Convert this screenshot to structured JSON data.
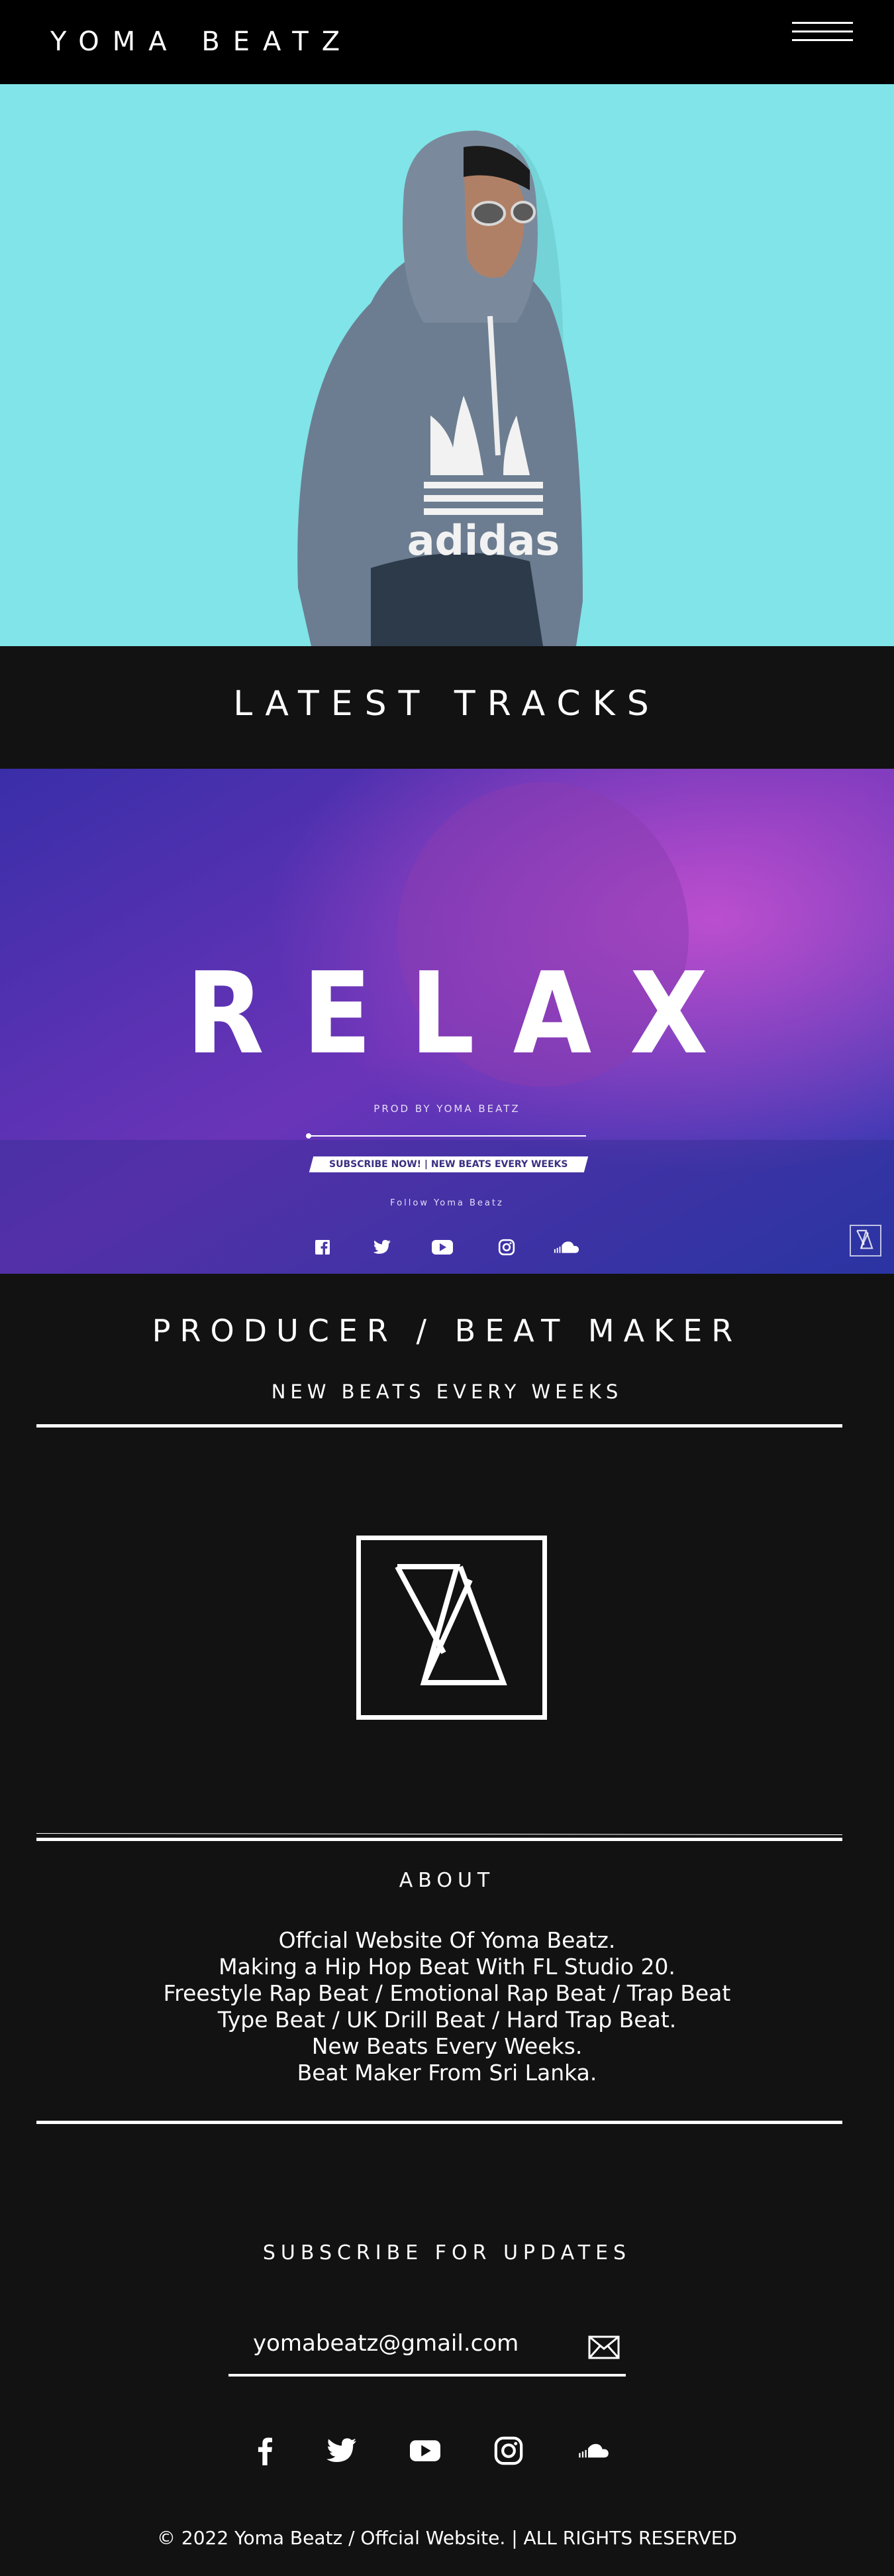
{
  "header": {
    "logo": "YOMA BEATZ",
    "menu_icon": "hamburger-menu-icon"
  },
  "latest": {
    "title": "LATEST TRACKS"
  },
  "track": {
    "title": "RELAX",
    "prod": "PROD BY YOMA BEATZ",
    "subscribe": "SUBSCRIBE NOW! | NEW BEATS EVERY WEEKS",
    "follow": "Follow Yoma Beatz",
    "socials": [
      "facebook-icon",
      "twitter-icon",
      "youtube-icon",
      "instagram-icon",
      "soundcloud-icon"
    ]
  },
  "producer": {
    "title": "PRODUCER / BEAT MAKER",
    "subtitle": "NEW BEATS EVERY WEEKS"
  },
  "about": {
    "title": "ABOUT",
    "lines": [
      "Offcial Website Of Yoma Beatz.",
      "Making a Hip Hop Beat With FL Studio 20.",
      "Freestyle Rap Beat / Emotional Rap Beat / Trap Beat",
      "Type Beat / UK Drill Beat / Hard Trap Beat.",
      "New Beats Every Weeks.",
      "Beat Maker From Sri Lanka."
    ]
  },
  "subscribe": {
    "title": "SUBSCRIBE FOR UPDATES",
    "email_value": "yomabeatz@gmail.com"
  },
  "socials": [
    "facebook-icon",
    "twitter-icon",
    "youtube-icon",
    "instagram-icon",
    "soundcloud-icon"
  ],
  "footer": {
    "text": "© 2022  Yoma Beatz / Offcial Website.  |  ALL  RIGHTS  RESERVED"
  },
  "colors": {
    "hero_bg": "#80e4e8",
    "header_bg": "#000000",
    "page_bg": "#121212"
  }
}
